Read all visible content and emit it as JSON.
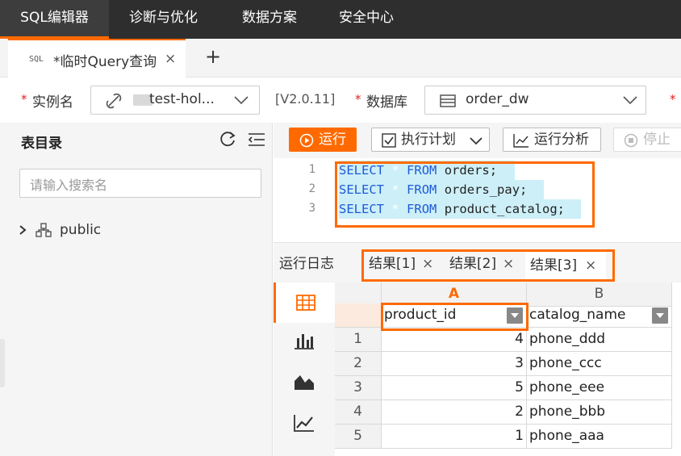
{
  "topnav": {
    "items": [
      "SQL编辑器",
      "诊断与优化",
      "数据方案",
      "安全中心"
    ]
  },
  "query_tab": {
    "badge": "SQL",
    "title": "*临时Query查询",
    "close": "×",
    "add": "+"
  },
  "toolbar": {
    "instance_label": "实例名",
    "instance_value": "test-hol...",
    "version": "[V2.0.11]",
    "db_label": "数据库",
    "db_value": "order_dw",
    "required_mark": "*"
  },
  "left_panel": {
    "title": "表目录",
    "search_placeholder": "请输入搜索名",
    "tree_item": "public"
  },
  "editor_bar": {
    "run": "运行",
    "plan": "执行计划",
    "analyze": "运行分析",
    "stop": "停止"
  },
  "editor": {
    "lines": [
      {
        "num": "1",
        "kw1": "SELECT",
        "star": "*",
        "kw2": "FROM",
        "rest": "orders;"
      },
      {
        "num": "2",
        "kw1": "SELECT",
        "star": "*",
        "kw2": "FROM",
        "rest": "orders_pay;"
      },
      {
        "num": "3",
        "kw1": "SELECT",
        "star": "*",
        "kw2": "FROM",
        "rest": "product_catalog;"
      }
    ]
  },
  "result_tabs": {
    "log": "运行日志",
    "tabs": [
      "结果[1]",
      "结果[2]",
      "结果[3]"
    ],
    "close": "×"
  },
  "grid": {
    "col_letters": [
      "A",
      "B"
    ],
    "columns": [
      "product_id",
      "catalog_name"
    ],
    "rows": [
      {
        "n": "1",
        "id": "4",
        "name": "phone_ddd"
      },
      {
        "n": "2",
        "id": "3",
        "name": "phone_ccc"
      },
      {
        "n": "3",
        "id": "5",
        "name": "phone_eee"
      },
      {
        "n": "4",
        "id": "2",
        "name": "phone_bbb"
      },
      {
        "n": "5",
        "id": "1",
        "name": "phone_aaa"
      }
    ]
  },
  "colors": {
    "accent": "#ff6a00",
    "nav_bg": "#2e2e2e",
    "keyword": "#1e5bd8",
    "selection": "#cdeff8"
  }
}
